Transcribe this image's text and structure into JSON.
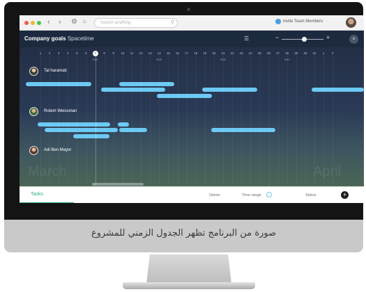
{
  "browser": {
    "search_placeholder": "Search anything",
    "invite_label": "Invite Team Members"
  },
  "header": {
    "title": "Company goals",
    "subtitle": "Spacetime",
    "zoom_minus": "−",
    "zoom_plus": "+",
    "close": "×"
  },
  "timeline": {
    "days": [
      "1",
      "2",
      "3",
      "4",
      "5",
      "6",
      "7",
      "8",
      "9",
      "10",
      "11",
      "12",
      "13",
      "14",
      "15",
      "16",
      "17",
      "18",
      "19",
      "20",
      "21",
      "22",
      "23",
      "24",
      "25",
      "26",
      "27",
      "28",
      "29",
      "30",
      "31",
      "1",
      "2"
    ],
    "today": "7",
    "sun_label": "Sun",
    "months": [
      "March",
      "April"
    ],
    "people": [
      {
        "name": "Tal haramati"
      },
      {
        "name": "Rotem Weissman"
      },
      {
        "name": "Adi Ben Mayor"
      }
    ]
  },
  "panel": {
    "tasks_label": "Tasks",
    "owner_label": "Owner",
    "time_range_label": "Time range",
    "status_label": "Status",
    "add_label": "+"
  },
  "caption": "صورة من البرنامج تظهر الجدول الزمني للمشروع",
  "colors": {
    "accent_green": "#2fb17a",
    "bar_blue": "#6cc9f3",
    "timeline_bg": "#232f45"
  }
}
